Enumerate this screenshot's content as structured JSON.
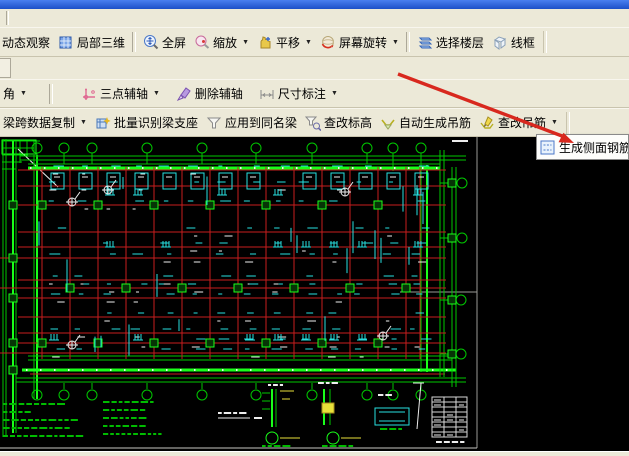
{
  "glyphs": {
    "dropdown_arrow": "▼"
  },
  "toolbar_main": {
    "items": [
      {
        "label": "动态观察",
        "dropdown": false
      },
      {
        "label": "局部三维",
        "dropdown": false
      },
      {
        "label": "全屏",
        "dropdown": false
      },
      {
        "label": "缩放",
        "dropdown": true
      },
      {
        "label": "平移",
        "dropdown": true
      },
      {
        "label": "屏幕旋转",
        "dropdown": true
      },
      {
        "label": "选择楼层",
        "dropdown": false
      },
      {
        "label": "线框",
        "dropdown": false
      }
    ]
  },
  "toolbar_axis": {
    "items": [
      {
        "label": "角",
        "dropdown": true
      },
      {
        "label": "三点辅轴",
        "dropdown": true
      },
      {
        "label": "删除辅轴",
        "dropdown": false
      },
      {
        "label": "尺寸标注",
        "dropdown": true
      }
    ]
  },
  "toolbar_beam": {
    "items": [
      {
        "label": "梁跨数据复制",
        "dropdown": true
      },
      {
        "label": "批量识别梁支座",
        "dropdown": false
      },
      {
        "label": "应用到同名梁",
        "dropdown": false
      },
      {
        "label": "查改标高",
        "dropdown": false
      },
      {
        "label": "自动生成吊筋",
        "dropdown": false
      },
      {
        "label": "查改吊筋",
        "dropdown": true
      }
    ]
  },
  "popup_menu": {
    "items": [
      {
        "label": "生成侧面钢筋"
      }
    ]
  },
  "annotation": {
    "arrow_color": "#d8281e"
  },
  "canvas": {
    "background": "#000000",
    "colors": {
      "axis_green": "#00c800",
      "bright_green": "#1aff1a",
      "beam_red": "#c81e1e",
      "detail_cyan": "#27e0e0",
      "text_white": "#eeeeee",
      "note_green": "#00bb00",
      "yellow": "#e8e13a",
      "frame_gray": "#9a9a96"
    }
  }
}
